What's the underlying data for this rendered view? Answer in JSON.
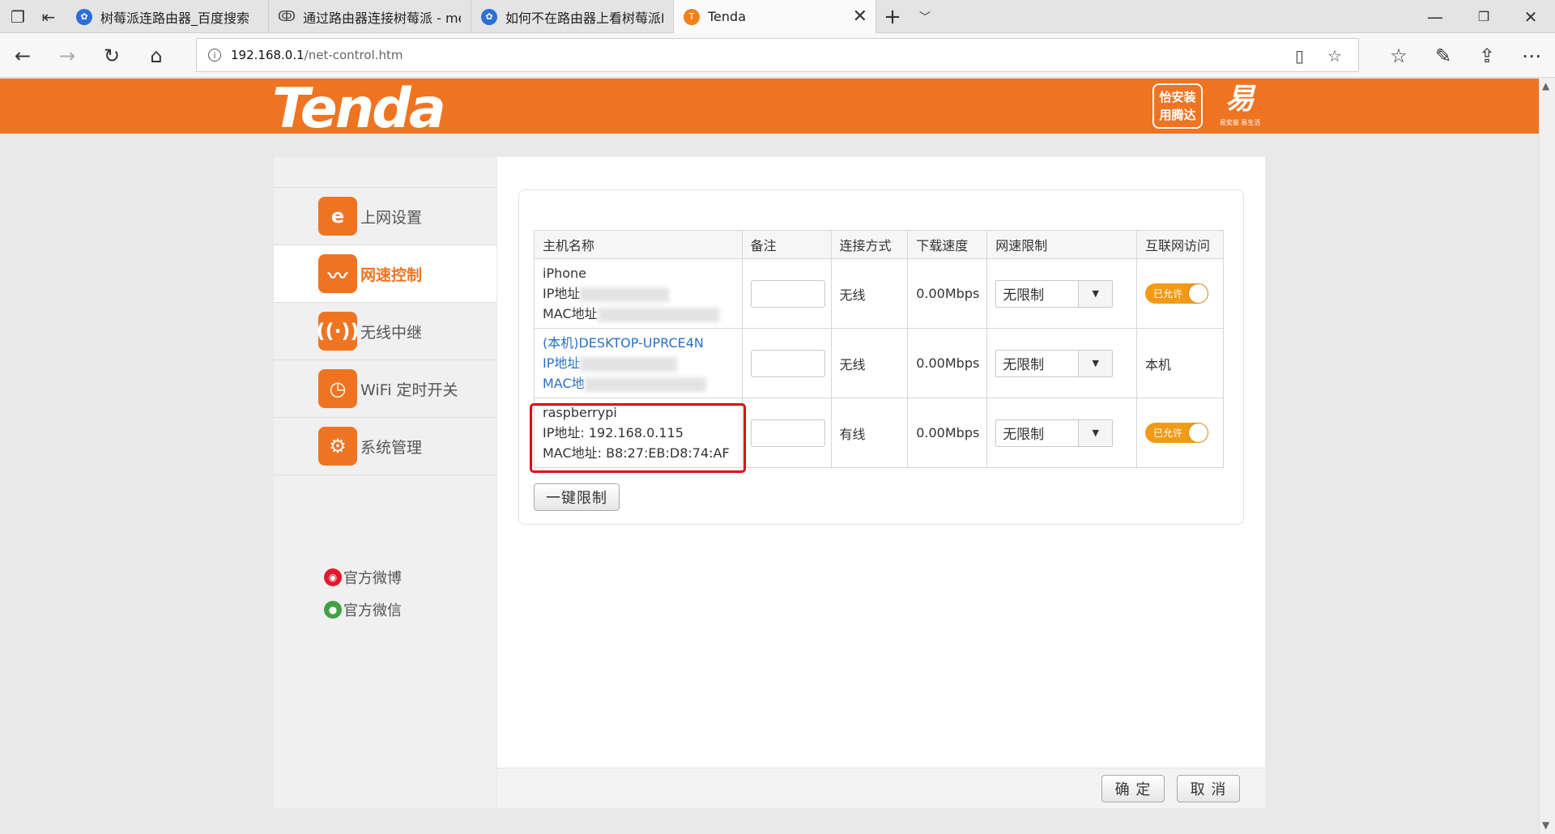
{
  "browser": {
    "tabs": [
      {
        "label": "树莓派连路由器_百度搜索",
        "favicon": "baidu-paw-icon"
      },
      {
        "label": "通过路由器连接树莓派 - me",
        "favicon": "csdn-icon"
      },
      {
        "label": "如何不在路由器上看树莓派I",
        "favicon": "baidu-paw-icon"
      },
      {
        "label": "Tenda",
        "favicon": "tenda-icon"
      }
    ],
    "url_host": "192.168.0.1",
    "url_path": "/net-control.htm"
  },
  "header": {
    "logo_text": "Tenda",
    "badge_line1": "怡安装",
    "badge_line2": "用腾达",
    "badge2_small": "易安装 易生活"
  },
  "sidebar": {
    "items": [
      {
        "label": "上网设置",
        "icon": "internet-e-icon"
      },
      {
        "label": "网速控制",
        "icon": "speed-wave-icon"
      },
      {
        "label": "无线中继",
        "icon": "wireless-repeater-icon"
      },
      {
        "label": "WiFi 定时开关",
        "icon": "wifi-timer-icon"
      },
      {
        "label": "系统管理",
        "icon": "gear-icon"
      }
    ],
    "social": [
      {
        "label": "官方微博",
        "icon": "weibo-icon"
      },
      {
        "label": "官方微信",
        "icon": "wechat-icon"
      }
    ]
  },
  "table": {
    "headers": [
      "主机名称",
      "备注",
      "连接方式",
      "下载速度",
      "网速限制",
      "互联网访问"
    ],
    "rows": [
      {
        "name": "iPhone",
        "ip_label": "IP地址",
        "mac_label": "MAC地址",
        "connection": "无线",
        "speed": "0.00Mbps",
        "limit": "无限制",
        "access": "已允许"
      },
      {
        "name": "(本机)DESKTOP-UPRCE4N",
        "ip_label": "IP地址",
        "mac_label": "MAC地",
        "connection": "无线",
        "speed": "0.00Mbps",
        "limit": "无限制",
        "access": "本机"
      },
      {
        "name": "raspberrypi",
        "ip_label": "IP地址: 192.168.0.115",
        "mac_label": "MAC地址: B8:27:EB:D8:74:AF",
        "connection": "有线",
        "speed": "0.00Mbps",
        "limit": "无限制",
        "access": "已允许"
      }
    ]
  },
  "buttons": {
    "one_click_limit": "一键限制",
    "confirm": "确 定",
    "cancel": "取 消"
  },
  "colors": {
    "brand_orange": "#ef7422",
    "toggle_on": "#f29a18",
    "highlight_red": "#e60012",
    "wired_green": "#2e9b2e",
    "link_blue": "#2a6fc3"
  }
}
